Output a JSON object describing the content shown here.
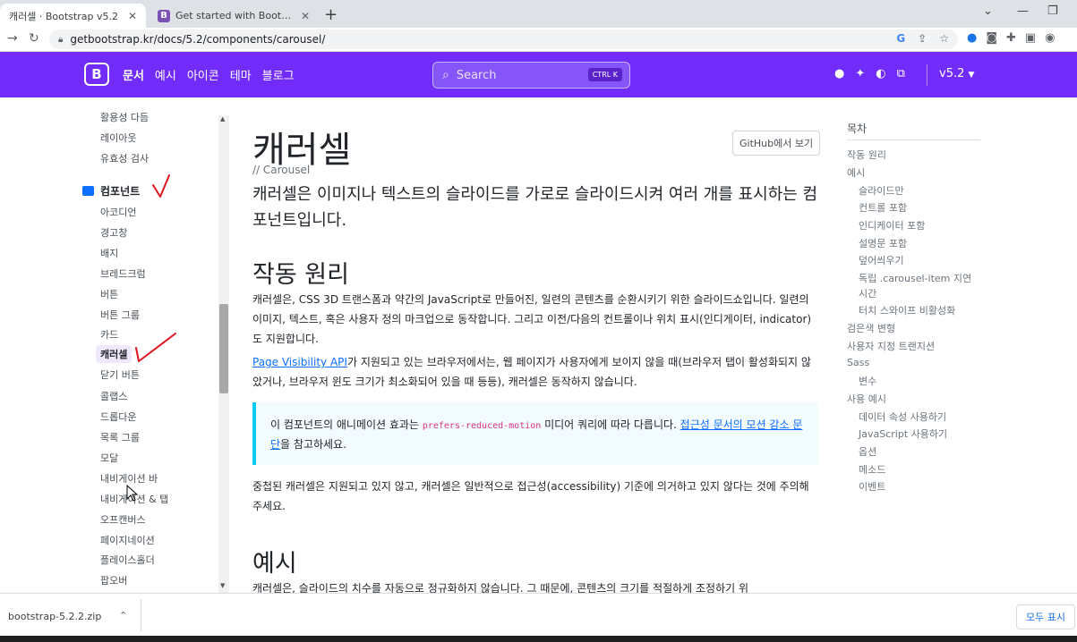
{
  "browser": {
    "tabs": [
      {
        "title": "캐러셀 · Bootstrap v5.2",
        "active": true
      },
      {
        "title": "Get started with Bootstrap · Boo",
        "active": false
      }
    ],
    "url": "getbootstrap.kr/docs/5.2/components/carousel/"
  },
  "navbar": {
    "brand": "B",
    "links": [
      "문서",
      "예시",
      "아이콘",
      "테마",
      "블로그"
    ],
    "search_placeholder": "Search",
    "search_shortcut": "CTRL K",
    "version": "v5.2"
  },
  "sidebar": {
    "top_items": [
      "활용성 다듬",
      "레이아웃",
      "유효성 검사"
    ],
    "section_title": "컴포넌트",
    "items": [
      "아코디언",
      "경고창",
      "배지",
      "브레드크럼",
      "버튼",
      "버튼 그룹",
      "카드",
      "캐러셀",
      "닫기 버튼",
      "콜랩스",
      "드롭다운",
      "목록 그룹",
      "모달",
      "내비게이션 바",
      "내비게이션 & 탭",
      "오프캔버스",
      "페이지네이션",
      "플레이스홀더",
      "팝오버"
    ],
    "active_item": "캐러셀"
  },
  "main": {
    "title": "캐러셀",
    "subtitle": "// Carousel",
    "github_button": "GitHub에서 보기",
    "lead": "캐러셀은 이미지나 텍스트의 슬라이드를 가로로 슬라이드시켜 여러 개를 표시하는 컴포넌트입니다.",
    "how_it_works": {
      "heading": "작동 원리",
      "p1": "캐러셀은, CSS 3D 트랜스폼과 약간의 JavaScript로 만들어진, 일련의 콘텐츠를 순환시키기 위한 슬라이드쇼입니다. 일련의 이미지, 텍스트, 혹은 사용자 정의 마크업으로 동작합니다. 그리고 이전/다음의 컨트롤이나 위치 표시(인디게이터, indicator)도 지원합니다.",
      "p2_link": "Page Visibility API",
      "p2_rest": "가 지원되고 있는 브라우저에서는, 웹 페이지가 사용자에게 보이지 않을 때(브라우저 탭이 활성화되지 않았거나, 브라우저 윈도 크기가 최소화되어 있을 때 등등), 캐러셀은 동작하지 않습니다.",
      "callout_pre": "이 컴포넌트의 애니메이션 효과는 ",
      "callout_code": "prefers-reduced-motion",
      "callout_mid": " 미디어 쿼리에 따라 다릅니다. ",
      "callout_link": "접근성 문서의 모션 감소 문단",
      "callout_post": "을 참고하세요.",
      "p3": "중첩된 캐러셀은 지원되고 있지 않고, 캐러셀은 일반적으로 접근성(accessibility) 기준에 의거하고 있지 않다는 것에 주의해 주세요."
    },
    "examples": {
      "heading": "예시",
      "p1": "캐러셀은, 슬라이드의 치수를 자동으로 정규화하지 않습니다. 그 때문에, 콘텐츠의 크기를 적절하게 조정하기 위"
    }
  },
  "toc": {
    "title": "목차",
    "items": [
      {
        "label": "작동 원리",
        "level": 1
      },
      {
        "label": "예시",
        "level": 1
      },
      {
        "label": "슬라이드만",
        "level": 2
      },
      {
        "label": "컨트롤 포함",
        "level": 2
      },
      {
        "label": "인디케이터 포함",
        "level": 2
      },
      {
        "label": "설명문 포함",
        "level": 2
      },
      {
        "label": "덮어씌우기",
        "level": 2
      },
      {
        "label": "독립 .carousel-item 지연",
        "level": 2
      },
      {
        "label": "시간",
        "level": 2
      },
      {
        "label": "터치 스와이프 비활성화",
        "level": 2
      },
      {
        "label": "검은색 변형",
        "level": 1
      },
      {
        "label": "사용자 지정 트랜지션",
        "level": 1
      },
      {
        "label": "Sass",
        "level": 1
      },
      {
        "label": "변수",
        "level": 2
      },
      {
        "label": "사용 예시",
        "level": 1
      },
      {
        "label": "데이터 속성 사용하기",
        "level": 2
      },
      {
        "label": "JavaScript 사용하기",
        "level": 2
      },
      {
        "label": "옵션",
        "level": 2
      },
      {
        "label": "메소드",
        "level": 2
      },
      {
        "label": "이벤트",
        "level": 2
      }
    ]
  },
  "downloads": {
    "file": "bootstrap-5.2.2.zip",
    "show_all": "모두 표시"
  },
  "colors": {
    "brand_purple": "#712cf9",
    "annotation_red": "#e0141e",
    "callout_border": "#0dcaf0",
    "link": "#0d6efd"
  }
}
